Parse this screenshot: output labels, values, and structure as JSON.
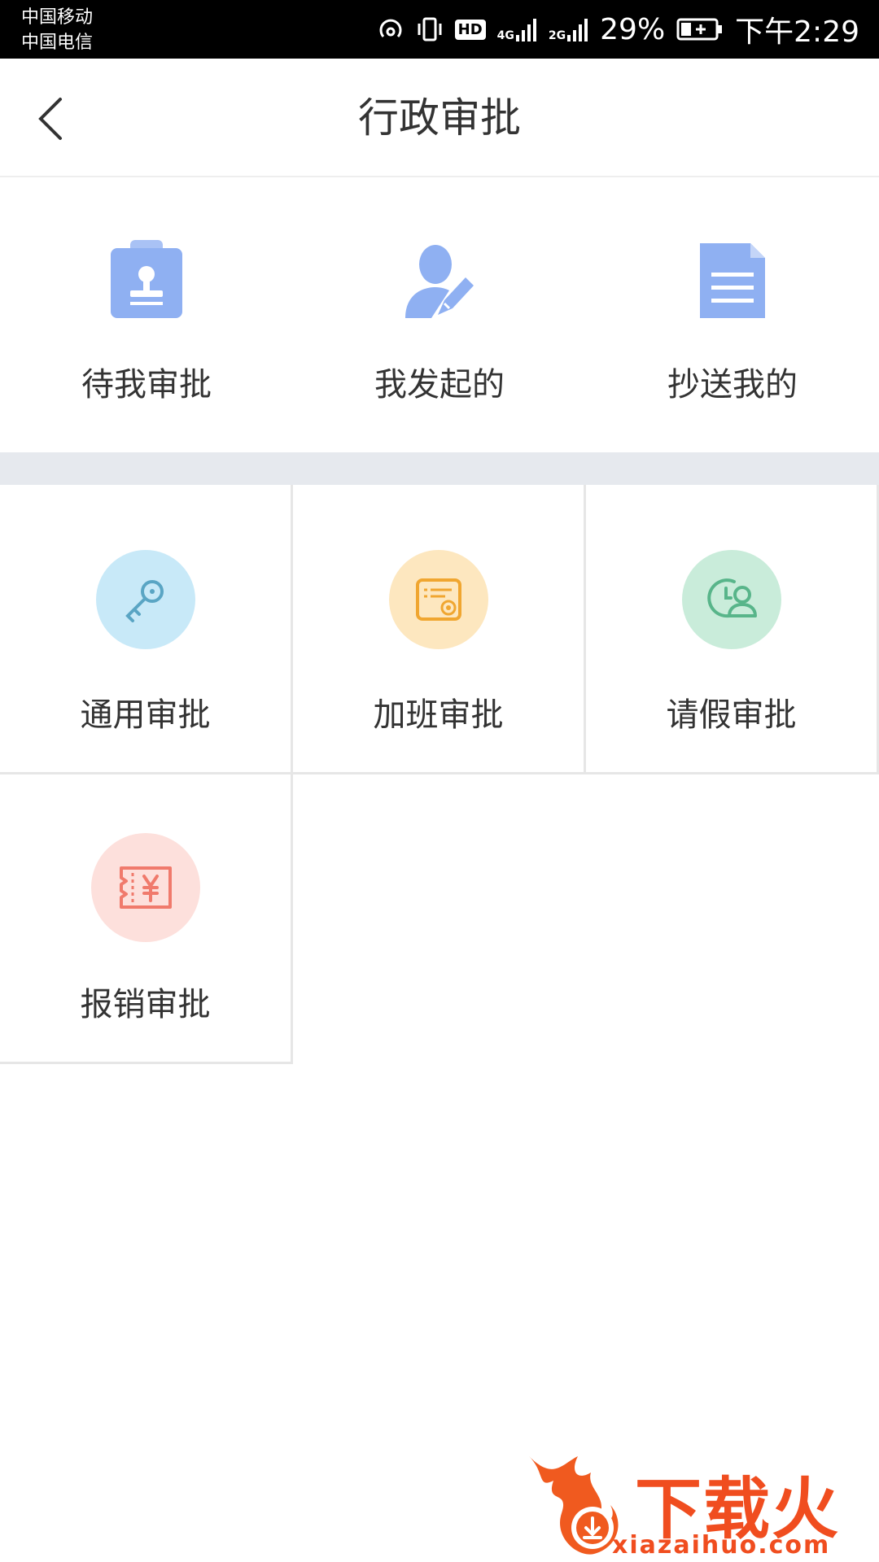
{
  "status_bar": {
    "carrier1": "中国移动",
    "carrier2": "中国电信",
    "hd": "HD",
    "net1": "4G",
    "net2": "2G",
    "battery": "29%",
    "time": "下午2:29"
  },
  "header": {
    "title": "行政审批",
    "back_icon": "chevron-left-icon"
  },
  "quick_actions": [
    {
      "label": "待我审批",
      "icon": "badge-stamp-icon",
      "color": "#8fb0f2"
    },
    {
      "label": "我发起的",
      "icon": "user-edit-icon",
      "color": "#8fb0f2"
    },
    {
      "label": "抄送我的",
      "icon": "document-icon",
      "color": "#8fb0f2"
    }
  ],
  "approval_types": [
    {
      "label": "通用审批",
      "icon": "key-icon",
      "bg": "#c8e9f8",
      "fg": "#5aa5c4"
    },
    {
      "label": "加班审批",
      "icon": "certificate-icon",
      "bg": "#fde7bf",
      "fg": "#f0a630"
    },
    {
      "label": "请假审批",
      "icon": "clock-user-icon",
      "bg": "#c9ecda",
      "fg": "#58b58a"
    },
    {
      "label": "报销审批",
      "icon": "yuan-ticket-icon",
      "bg": "#fde0dc",
      "fg": "#f07a6c"
    }
  ],
  "watermark": {
    "text": "下载火",
    "url": "xiazaihuo.com"
  }
}
